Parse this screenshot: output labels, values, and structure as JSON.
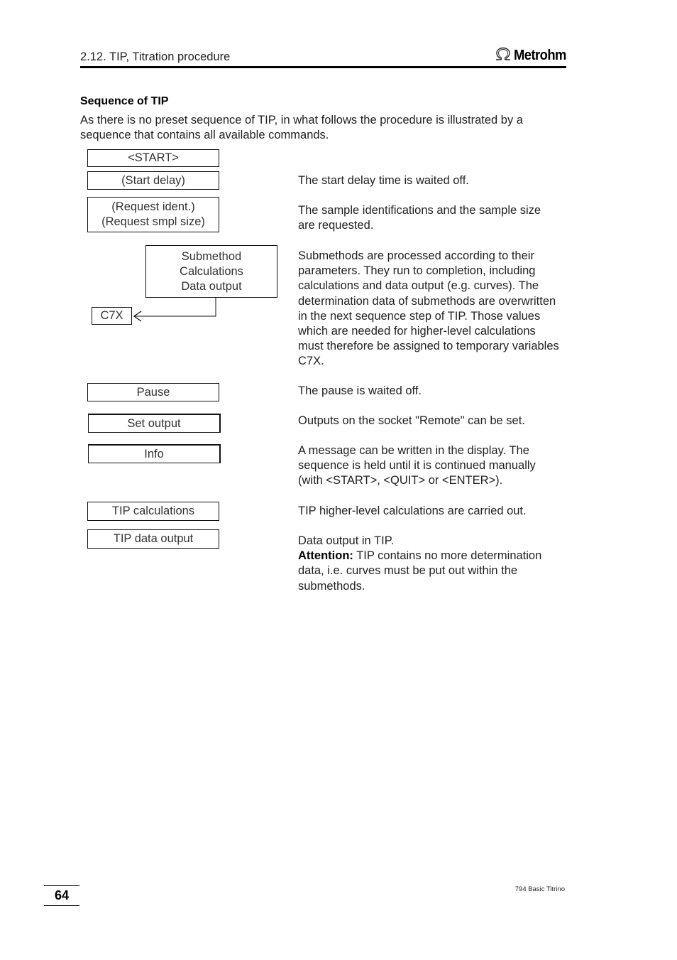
{
  "header": {
    "section_title": "2.12. TIP, Titration procedure",
    "logo_text": "Metrohm",
    "logo_icon": "omega-icon"
  },
  "content": {
    "heading": "Sequence of TIP",
    "intro": "As there is no preset sequence of TIP, in what follows the procedure is illustrated by a sequence that contains all available commands.",
    "flow_boxes": {
      "start": "<START>",
      "start_delay": "(Start delay)",
      "request_ident": "(Request ident.)",
      "request_smpl": "(Request smpl size)",
      "submethod": [
        "Submethod",
        "Calculations",
        "Data output"
      ],
      "c7x": "C7X",
      "pause": "Pause",
      "set_output": "Set output",
      "info": "Info",
      "tip_calculations": "TIP calculations",
      "tip_data_output": "TIP data output"
    },
    "descriptions": {
      "start_delay": "The start delay time is waited off.",
      "request": "The sample identifications and the sample size are requested.",
      "submethod": "Submethods are processed according to their parameters. They run to completion, including calculations and data output (e.g. curves). The determination data of submethods are overwritten in the next sequence step of TIP. Those values which are needed for higher-level calculations must therefore be assigned to temporary variables C7X.",
      "pause": "The pause is waited off.",
      "set_output": "Outputs on the socket \"Remote\" can be set.",
      "info": "A message can be written in the display. The sequence is held until it is continued manually (with <START>, <QUIT> or <ENTER>).",
      "tip_calculations": "TIP higher-level calculations are carried out.",
      "tip_data_output_line": "Data output in TIP.",
      "attention_label": "Attention:",
      "attention_text": " TIP contains no more determination data, i.e. curves must be put out within the submethods."
    }
  },
  "footer": {
    "page_number": "64",
    "document_name": "794 Basic Titrino"
  }
}
